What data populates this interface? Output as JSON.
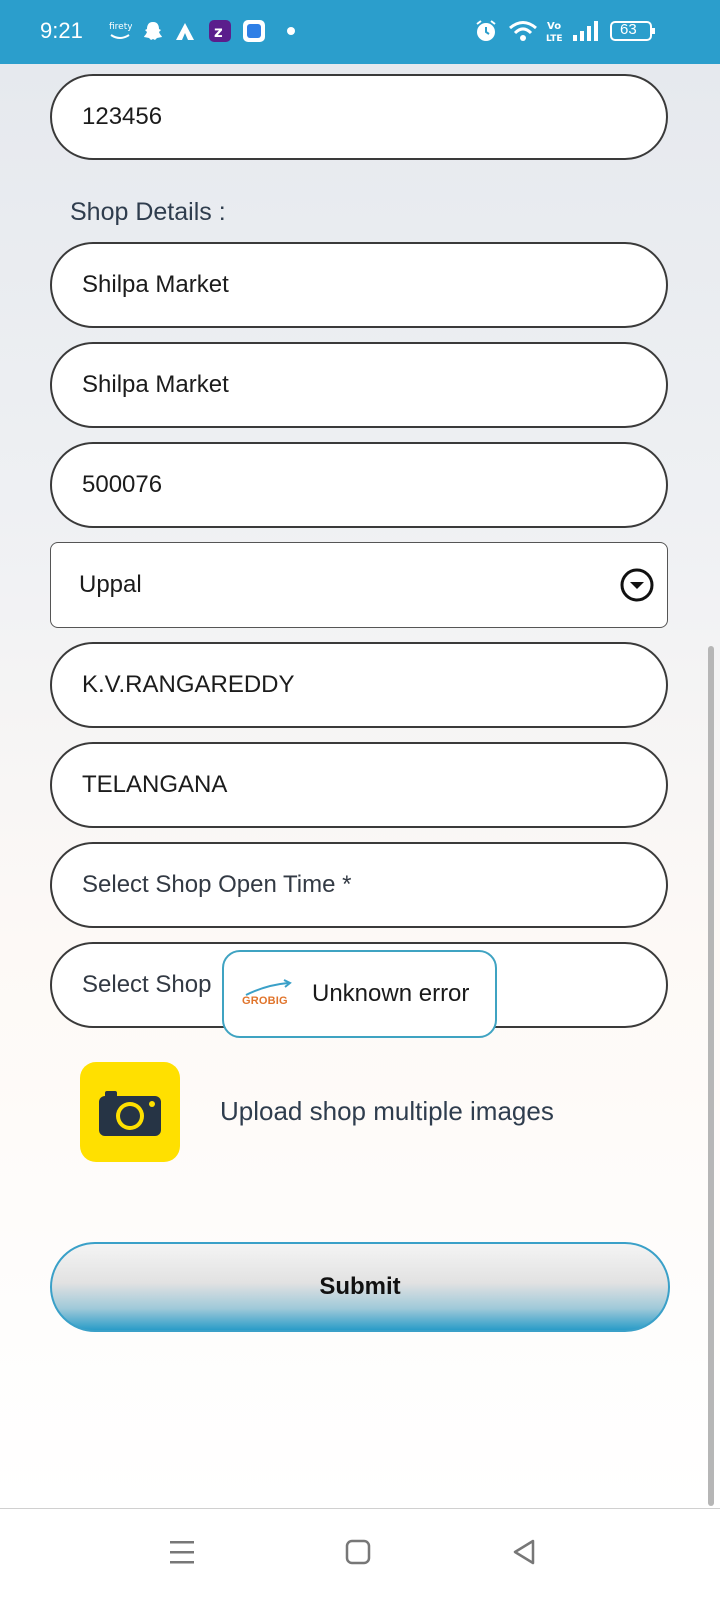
{
  "status_bar": {
    "time": "9:21",
    "battery": "63",
    "network": "Vo LTE"
  },
  "form": {
    "code_value": "123456",
    "shop_details_label": "Shop Details :",
    "shop_name": "Shilpa Market",
    "shop_address": "Shilpa Market",
    "pincode": "500076",
    "area_select": "Uppal",
    "district": "K.V.RANGAREDDY",
    "state": "TELANGANA",
    "open_time_placeholder": "Select Shop Open Time *",
    "close_time_placeholder_visible": "Select Shop",
    "upload_label": "Upload shop multiple images",
    "submit_label": "Submit"
  },
  "toast": {
    "logo_text": "GROBIG",
    "message": "Unknown error"
  },
  "colors": {
    "status_bar": "#2b9ecc",
    "camera_tile": "#ffe000",
    "submit_accent": "#2a9cc8",
    "toast_border": "#3fa3c2"
  },
  "icons": {
    "camera": "camera-icon",
    "dropdown": "chevron-down-circle-icon",
    "nav_menu": "menu-icon",
    "nav_home": "home-square-icon",
    "nav_back": "back-triangle-icon"
  }
}
